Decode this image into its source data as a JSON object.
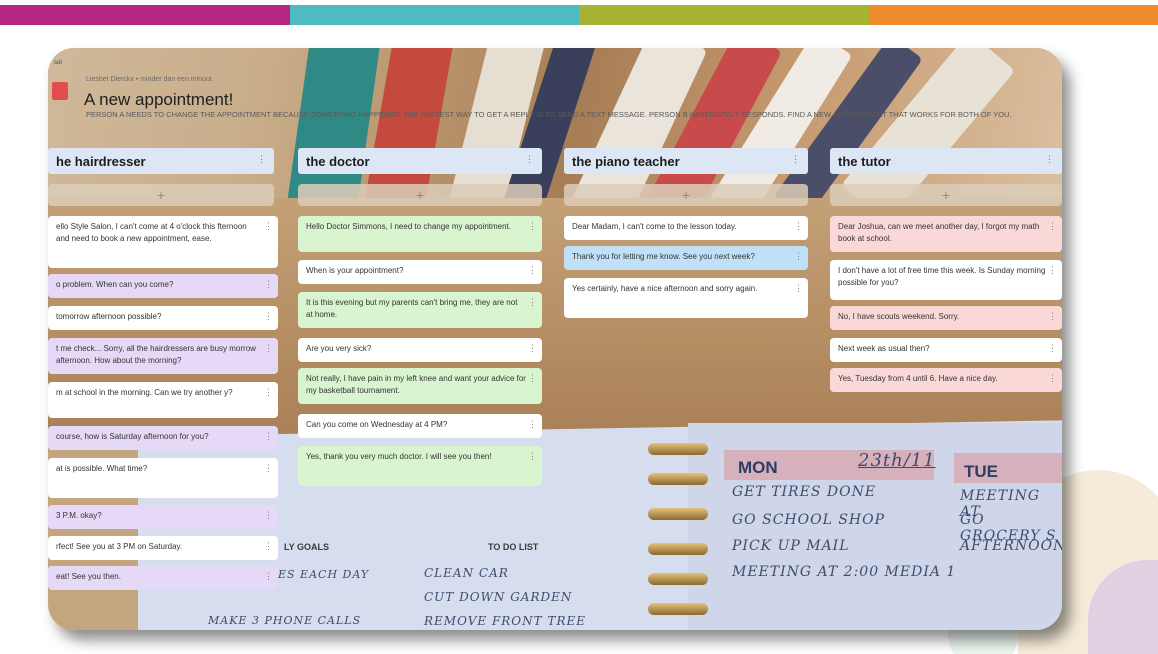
{
  "stripe_colors": [
    "#b5267f",
    "#4fb9c4",
    "#a5b334",
    "#ef8b2c"
  ],
  "board": {
    "author": "Liesbet Dierckx • minder dan een minuut",
    "title": "A new appointment!",
    "description": "PERSON A NEEDS TO CHANGE THE APPOINTMENT BECAUSE SOMETHING HAPPENED. THE FASTEST WAY TO GET A REPLY IS TO SEND A TEXT MESSAGE. PERSON B IMMEDIATELY RESPONDS. FIND A NEW APPOINTMENT THAT WORKS FOR BOTH OF YOU.",
    "corner_label": "sol"
  },
  "columns": [
    {
      "title": "he hairdresser",
      "add_label": "+",
      "menu": "⋮",
      "cards": [
        {
          "text": "ello Style Salon, I can't come at 4 o'clock this fternoon and need to book a new appointment, ease.",
          "color": "white"
        },
        {
          "text": "o problem. When can you come?",
          "color": "purple"
        },
        {
          "text": "tomorrow afternoon possible?",
          "color": "white"
        },
        {
          "text": "t me check... Sorry, all the hairdressers are busy morrow afternoon. How about the morning?",
          "color": "purple"
        },
        {
          "text": "m at school in the morning. Can we try another y?",
          "color": "white"
        },
        {
          "text": "course, how is Saturday afternoon for you?",
          "color": "purple"
        },
        {
          "text": "at is possible. What time?",
          "color": "white"
        },
        {
          "text": "3 P.M. okay?",
          "color": "purple"
        },
        {
          "text": "rfect! See you at 3 PM on Saturday.",
          "color": "white"
        },
        {
          "text": "eat! See you then.",
          "color": "purple"
        }
      ]
    },
    {
      "title": "the doctor",
      "add_label": "+",
      "menu": "⋮",
      "cards": [
        {
          "text": "Hello Doctor Simmons, I need to change my appointment.",
          "color": "green"
        },
        {
          "text": "When is your appointment?",
          "color": "white"
        },
        {
          "text": "It is this evening but my parents can't bring me, they are not at home.",
          "color": "green"
        },
        {
          "text": "Are you very sick?",
          "color": "white"
        },
        {
          "text": "Not really, I have pain in my left knee and want your advice for my basketball tournament.",
          "color": "green"
        },
        {
          "text": "Can you come on Wednesday at 4 PM?",
          "color": "white"
        },
        {
          "text": "Yes, thank you very much doctor. I will see you then!",
          "color": "green"
        }
      ]
    },
    {
      "title": "the piano teacher",
      "add_label": "+",
      "menu": "⋮",
      "cards": [
        {
          "text": "Dear Madam, I can't come to the lesson today.",
          "color": "white"
        },
        {
          "text": "Thank you for letting me know. See you next week?",
          "color": "blue"
        },
        {
          "text": "Yes certainly, have a nice afternoon and sorry again.",
          "color": "white"
        }
      ]
    },
    {
      "title": "the tutor",
      "add_label": "+",
      "menu": "⋮",
      "cards": [
        {
          "text": "Dear Joshua, can we meet another day, I forgot my math book at school.",
          "color": "pink"
        },
        {
          "text": "I don't have a lot of free time this week. Is Sunday morning possible for you?",
          "color": "white"
        },
        {
          "text": "No, I have scouts weekend. Sorry.",
          "color": "pink"
        },
        {
          "text": "Next week as usual then?",
          "color": "white"
        },
        {
          "text": "Yes, Tuesday from 4 until 6. Have a nice day.",
          "color": "pink"
        }
      ]
    }
  ],
  "planner": {
    "mon": "MON",
    "date": "23th/11",
    "tue": "TUE",
    "mon_items": [
      "GET TIRES DONE",
      "GO SCHOOL SHOP",
      "PICK UP MAIL",
      "MEETING AT 2:00 MEDIA 1"
    ],
    "tue_items": [
      "MEETING AT",
      "GO GROCERY S",
      "AFTERNOON"
    ],
    "goals_label": "LY GOALS",
    "todo_label": "TO DO LIST",
    "goals_items": [
      "ES EACH DAY",
      "MAKE 3 PHONE CALLS"
    ],
    "todo_items": [
      "CLEAN CAR",
      "CUT DOWN GARDEN",
      "REMOVE FRONT TREE"
    ]
  }
}
